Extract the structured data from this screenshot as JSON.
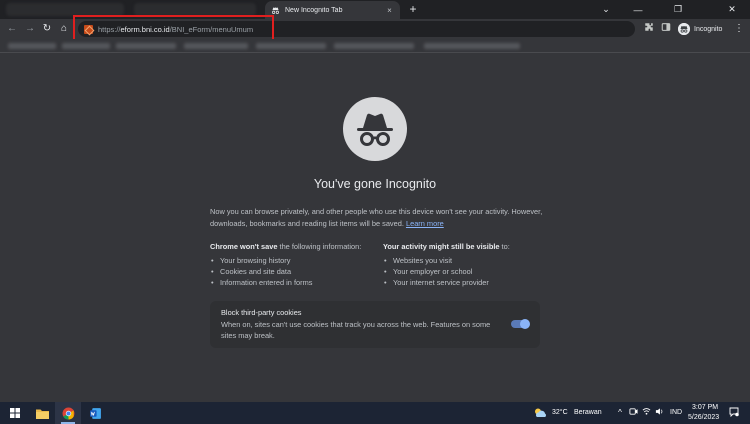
{
  "browser": {
    "active_tab_title": "New Incognito Tab",
    "new_tab_symbol": "+",
    "tab_close_symbol": "×",
    "window_controls": {
      "tab_search": "⌄",
      "minimize": "—",
      "maximize": "❐",
      "close": "✕"
    },
    "nav": {
      "back": "←",
      "forward": "→",
      "reload": "↻",
      "home": "⌂"
    },
    "url": {
      "scheme": "https://",
      "host": "eform.bni.co.id",
      "path": "/BNI_eForm/menuUmum"
    },
    "profile_label": "Incognito",
    "menu_symbol": "⋮"
  },
  "incognito_page": {
    "title": "You've gone Incognito",
    "intro": "Now you can browse privately, and other people who use this device won't see your activity. However, downloads, bookmarks and reading list items will be saved.",
    "learn_more": "Learn more",
    "wont_save": {
      "heading_bold": "Chrome won't save",
      "heading_rest": " the following information:",
      "items": [
        "Your browsing history",
        "Cookies and site data",
        "Information entered in forms"
      ]
    },
    "visible": {
      "heading_bold": "Your activity might still be visible",
      "heading_rest": " to:",
      "items": [
        "Websites you visit",
        "Your employer or school",
        "Your internet service provider"
      ]
    },
    "cookies_card": {
      "title": "Block third-party cookies",
      "description": "When on, sites can't use cookies that track you across the web. Features on some sites may break.",
      "toggle_on": true
    }
  },
  "taskbar": {
    "weather_temp": "32°C",
    "weather_desc": "Berawan",
    "language": "IND",
    "time": "3:07 PM",
    "date": "5/26/2023",
    "tray_chevron": "^"
  },
  "colors": {
    "page_bg": "#35363a",
    "frame_bg": "#202124",
    "link": "#8ab4f8",
    "highlight_box": "#e01f1f",
    "taskbar_bg": "#1c2434"
  }
}
